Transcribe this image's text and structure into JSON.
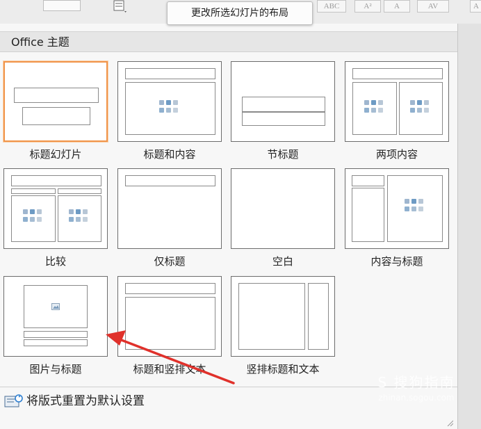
{
  "tooltip": "更改所选幻灯片的布局",
  "ribbon": {
    "buttons": [
      "ABC",
      "A²",
      "A",
      "AV",
      "A"
    ]
  },
  "gallery": {
    "section_title": "Office 主题",
    "layouts": [
      {
        "label": "标题幻灯片",
        "selected": true
      },
      {
        "label": "标题和内容",
        "selected": false
      },
      {
        "label": "节标题",
        "selected": false
      },
      {
        "label": "两项内容",
        "selected": false
      },
      {
        "label": "比较",
        "selected": false
      },
      {
        "label": "仅标题",
        "selected": false
      },
      {
        "label": "空白",
        "selected": false
      },
      {
        "label": "内容与标题",
        "selected": false
      },
      {
        "label": "图片与标题",
        "selected": false
      },
      {
        "label": "标题和竖排文本",
        "selected": false
      },
      {
        "label": "竖排标题和文本",
        "selected": false
      }
    ],
    "reset_label": "将版式重置为默认设置"
  },
  "icons": {
    "reset": "reset-layout-icon",
    "content_placeholder": "content-placeholder-icon",
    "picture_placeholder": "picture-icon"
  },
  "colors": {
    "selected_border": "#f0944a",
    "annotation_arrow": "#e0312b"
  },
  "watermark": {
    "line1": "S 搜狗指南",
    "line2": "zhinan.sogou.com"
  }
}
